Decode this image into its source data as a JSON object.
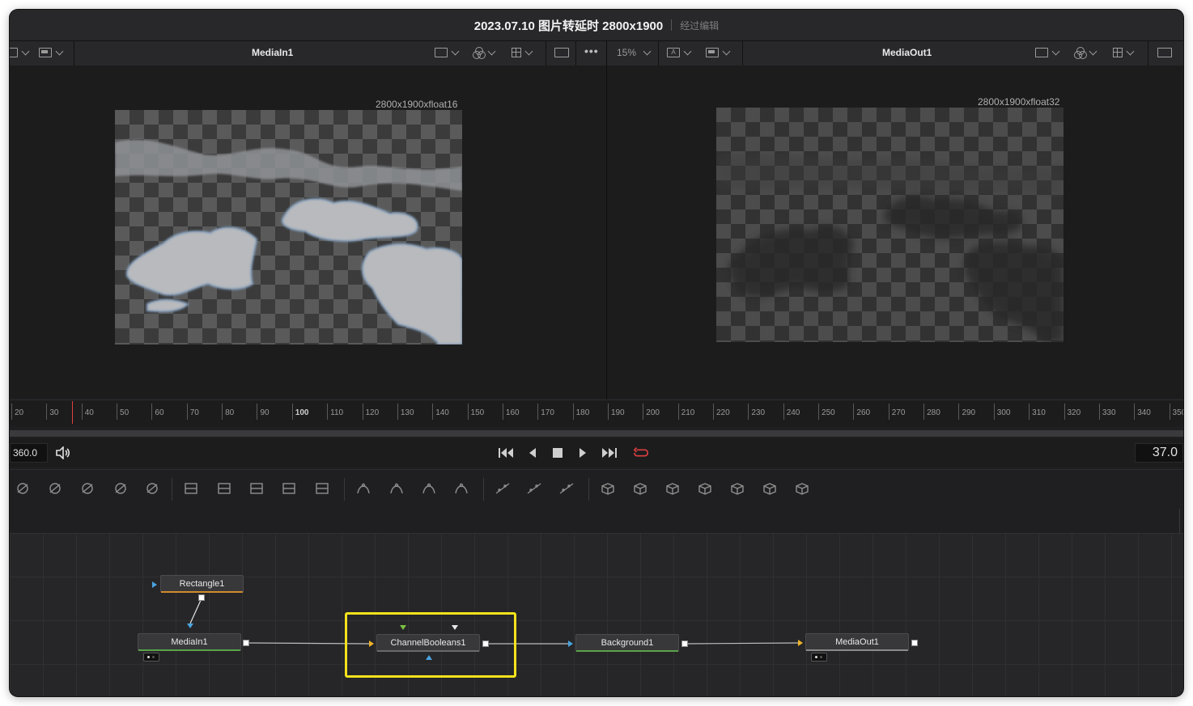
{
  "window": {
    "title": "2023.07.10 图片转延时 2800x1900",
    "subtitle": "经过编辑"
  },
  "viewers": {
    "left": {
      "name": "MediaIn1",
      "resolution": "2800x1900xfloat16"
    },
    "right": {
      "name": "MediaOut1",
      "resolution": "2800x1900xfloat32",
      "zoom": "15%",
      "more_label": "•••",
      "channel_badge": "A"
    }
  },
  "ruler": {
    "ticks": [
      "20",
      "30",
      "40",
      "50",
      "60",
      "70",
      "80",
      "90",
      "100",
      "110",
      "120",
      "130",
      "140",
      "150",
      "160",
      "170",
      "180",
      "190",
      "200",
      "210",
      "220",
      "230",
      "240",
      "250",
      "260",
      "270",
      "280",
      "290",
      "300",
      "310",
      "320",
      "330",
      "340",
      "350"
    ]
  },
  "transport": {
    "duration": "360.0",
    "current_frame": "37.0"
  },
  "toolbar": {
    "tools": [
      "particles-icon",
      "color-corrector-icon",
      "curves-icon",
      "brightness-icon",
      "blur-icon",
      "merge-icon",
      "background-icon",
      "loader-icon",
      "resize-icon",
      "transform-icon",
      "rectangle-mask-icon",
      "ellipse-mask-icon",
      "polygon-mask-icon",
      "bspline-mask-icon",
      "pemitter-icon",
      "prender-icon",
      "pmerge-icon",
      "shape3d-icon",
      "merge3d-icon",
      "text3d-icon",
      "camera3d-icon",
      "renderer3d-icon",
      "spotlight-icon",
      "image-plane-icon"
    ]
  },
  "nodes": {
    "rectangle": "Rectangle1",
    "mediain": "MediaIn1",
    "channelbooleans": "ChannelBooleans1",
    "background": "Background1",
    "mediaout": "MediaOut1"
  },
  "colors": {
    "highlight": "#f5e21c",
    "playhead": "#e04040",
    "loop_button": "#e04040",
    "node_green_bar": "#5aa34a",
    "node_orange_bar": "#d08a2a"
  }
}
